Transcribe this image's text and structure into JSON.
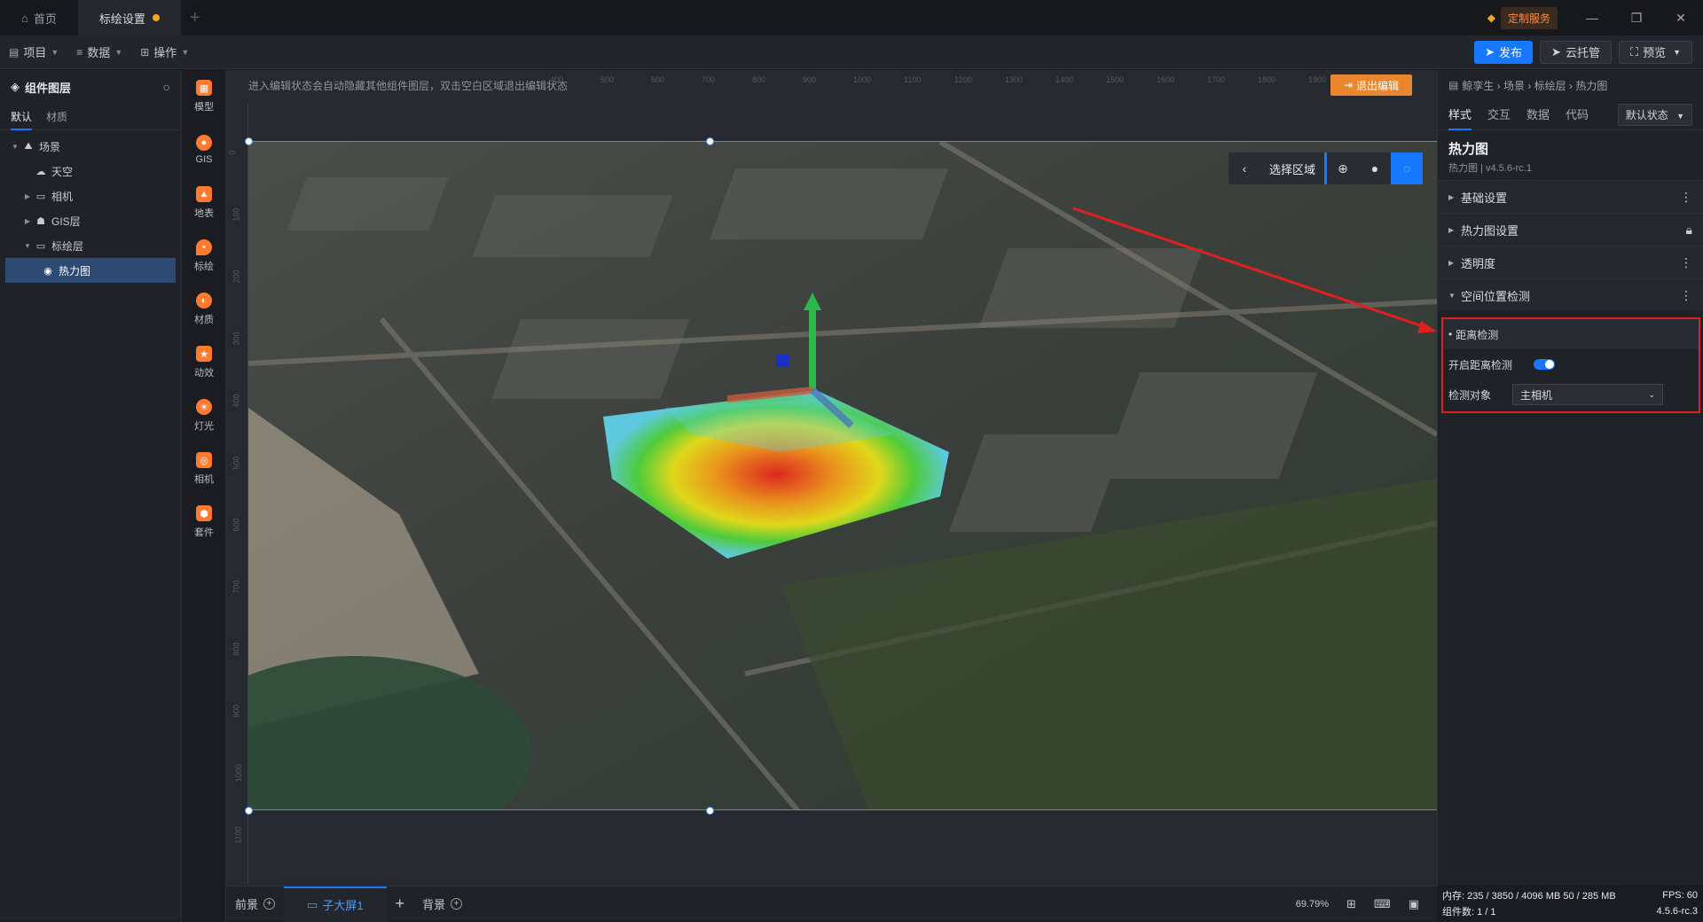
{
  "tabs": [
    {
      "label": "首页"
    },
    {
      "label": "标绘设置"
    }
  ],
  "custom_service": "定制服务",
  "menu": {
    "project": "项目",
    "data": "数据",
    "ops": "操作"
  },
  "toolbar": {
    "publish": "发布",
    "cloud": "云托管",
    "preview": "预览"
  },
  "layers": {
    "title": "组件图层",
    "tab_default": "默认",
    "tab_material": "材质",
    "items": [
      {
        "label": "场景"
      },
      {
        "label": "天空"
      },
      {
        "label": "相机"
      },
      {
        "label": "GIS层"
      },
      {
        "label": "标绘层"
      },
      {
        "label": "热力图"
      }
    ]
  },
  "iconbar": [
    {
      "label": "模型"
    },
    {
      "label": "GIS"
    },
    {
      "label": "地表"
    },
    {
      "label": "标绘"
    },
    {
      "label": "材质"
    },
    {
      "label": "动效"
    },
    {
      "label": "灯光"
    },
    {
      "label": "相机"
    },
    {
      "label": "套件"
    }
  ],
  "canvas": {
    "hint": "进入编辑状态会自动隐藏其他组件图层，双击空白区域退出编辑状态",
    "exit_edit": "退出编辑",
    "select_region": "选择区域",
    "ruler_top": [
      "400",
      "500",
      "600",
      "700",
      "800",
      "900",
      "1000",
      "1100",
      "1200",
      "1300",
      "1400",
      "1500",
      "1600",
      "1700",
      "1800",
      "1900"
    ],
    "ruler_left": [
      "0",
      "100",
      "200",
      "300",
      "400",
      "500",
      "600",
      "700",
      "800",
      "900",
      "1000",
      "1100"
    ]
  },
  "bottom": {
    "front": "前景",
    "screen": "子大屏1",
    "back": "背景",
    "zoom": "69.79%"
  },
  "right": {
    "breadcrumb": "鲸孪生 › 场景 › 标绘层 › 热力图",
    "tabs": [
      "样式",
      "交互",
      "数据",
      "代码"
    ],
    "state": "默认状态",
    "comp_title": "热力图",
    "comp_version": "热力图 | v4.5.6-rc.1",
    "sections": [
      {
        "label": "基础设置"
      },
      {
        "label": "热力图设置"
      },
      {
        "label": "透明度"
      },
      {
        "label": "空间位置检测"
      }
    ],
    "dist_title": "距离检测",
    "dist_enable_label": "开启距离检测",
    "dist_enable": true,
    "dist_target_label": "检测对象",
    "dist_target": "主相机"
  },
  "status": {
    "memory": "内存: 235 / 3850 / 4096 MB  50 / 285 MB",
    "fps": "FPS: 60",
    "count": "组件数: 1 / 1",
    "version": "4.5.6-rc.3"
  }
}
